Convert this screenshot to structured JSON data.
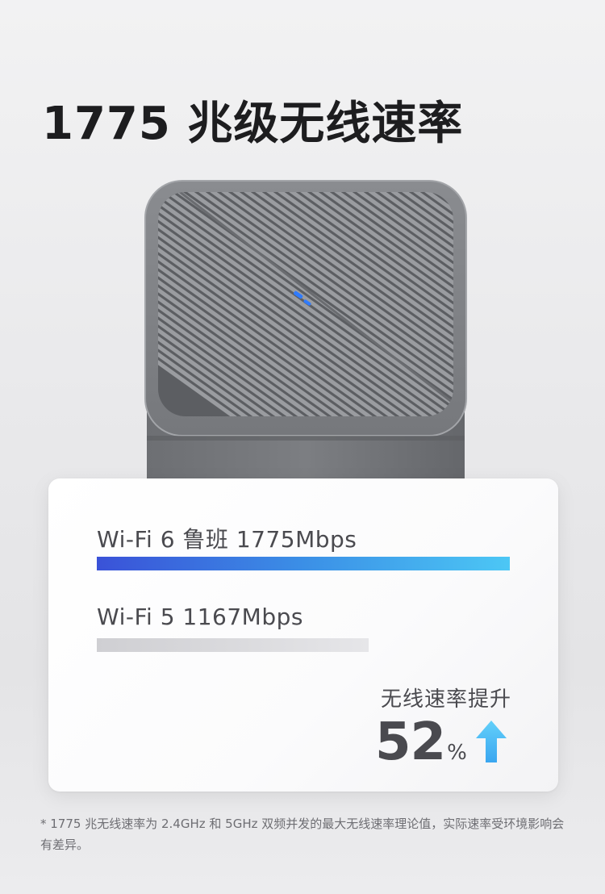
{
  "title": "1775 兆级无线速率",
  "card": {
    "wifi6": {
      "label": "Wi-Fi 6 鲁班  1775Mbps",
      "value_mbps": 1775
    },
    "wifi5": {
      "label": "Wi-Fi 5  1167Mbps",
      "value_mbps": 1167
    },
    "boost": {
      "caption": "无线速率提升",
      "value": "52",
      "unit": "%"
    }
  },
  "footnote": "* 1775 兆无线速率为 2.4GHz 和 5GHz 双频并发的最大无线速率理论值，实际速率受环境影响会有差异。",
  "colors": {
    "wifi6_bar_start": "#3a52d8",
    "wifi6_bar_end": "#4cc7f5",
    "wifi5_bar": "#d6d6d9",
    "arrow_start": "#3aa6f0",
    "arrow_end": "#63d0fa",
    "led": "#2f7bff"
  },
  "icons": {
    "boost_arrow": "up-arrow-icon",
    "status_light": "led-indicator"
  }
}
